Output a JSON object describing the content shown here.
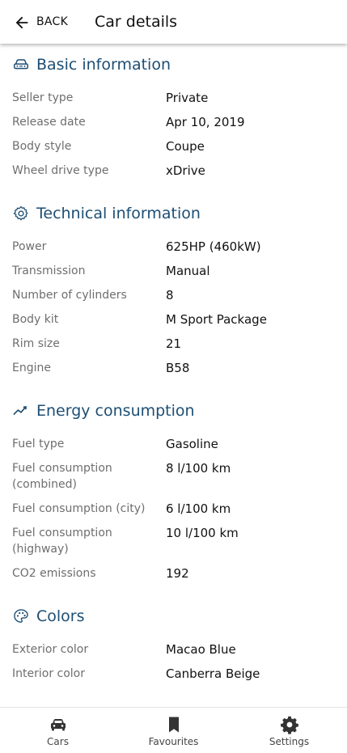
{
  "header": {
    "back_label": "BACK",
    "title": "Car details"
  },
  "colors": {
    "section_title": "#1d4e73",
    "label": "#6e6e6e",
    "value": "#111111"
  },
  "sections": {
    "basic": {
      "title": "Basic information",
      "icon": "car-icon",
      "rows": [
        {
          "label": "Seller type",
          "value": "Private"
        },
        {
          "label": "Release date",
          "value": "Apr 10, 2019"
        },
        {
          "label": "Body style",
          "value": "Coupe"
        },
        {
          "label": "Wheel drive type",
          "value": "xDrive"
        }
      ]
    },
    "technical": {
      "title": "Technical information",
      "icon": "gear-icon",
      "rows": [
        {
          "label": "Power",
          "value": "625HP (460kW)"
        },
        {
          "label": "Transmission",
          "value": "Manual"
        },
        {
          "label": "Number of cylinders",
          "value": "8"
        },
        {
          "label": "Body kit",
          "value": "M Sport Package"
        },
        {
          "label": "Rim size",
          "value": "21"
        },
        {
          "label": "Engine",
          "value": "B58"
        }
      ]
    },
    "energy": {
      "title": "Energy consumption",
      "icon": "trending-up-icon",
      "rows": [
        {
          "label": "Fuel type",
          "value": "Gasoline"
        },
        {
          "label": "Fuel consumption\n(combined)",
          "value": "8 l/100 km"
        },
        {
          "label": "Fuel consumption (city)",
          "value": "6 l/100 km"
        },
        {
          "label": "Fuel consumption\n(highway)",
          "value": "10 l/100 km"
        },
        {
          "label": "CO2 emissions",
          "value": "192"
        }
      ]
    },
    "colors": {
      "title": "Colors",
      "icon": "palette-icon",
      "rows": [
        {
          "label": "Exterior color",
          "value": "Macao Blue"
        },
        {
          "label": "Interior color",
          "value": "Canberra Beige"
        }
      ]
    }
  },
  "bottom_nav": {
    "items": [
      {
        "label": "Cars",
        "icon": "car-icon"
      },
      {
        "label": "Favourites",
        "icon": "bookmark-icon"
      },
      {
        "label": "Settings",
        "icon": "gear-icon"
      }
    ]
  }
}
